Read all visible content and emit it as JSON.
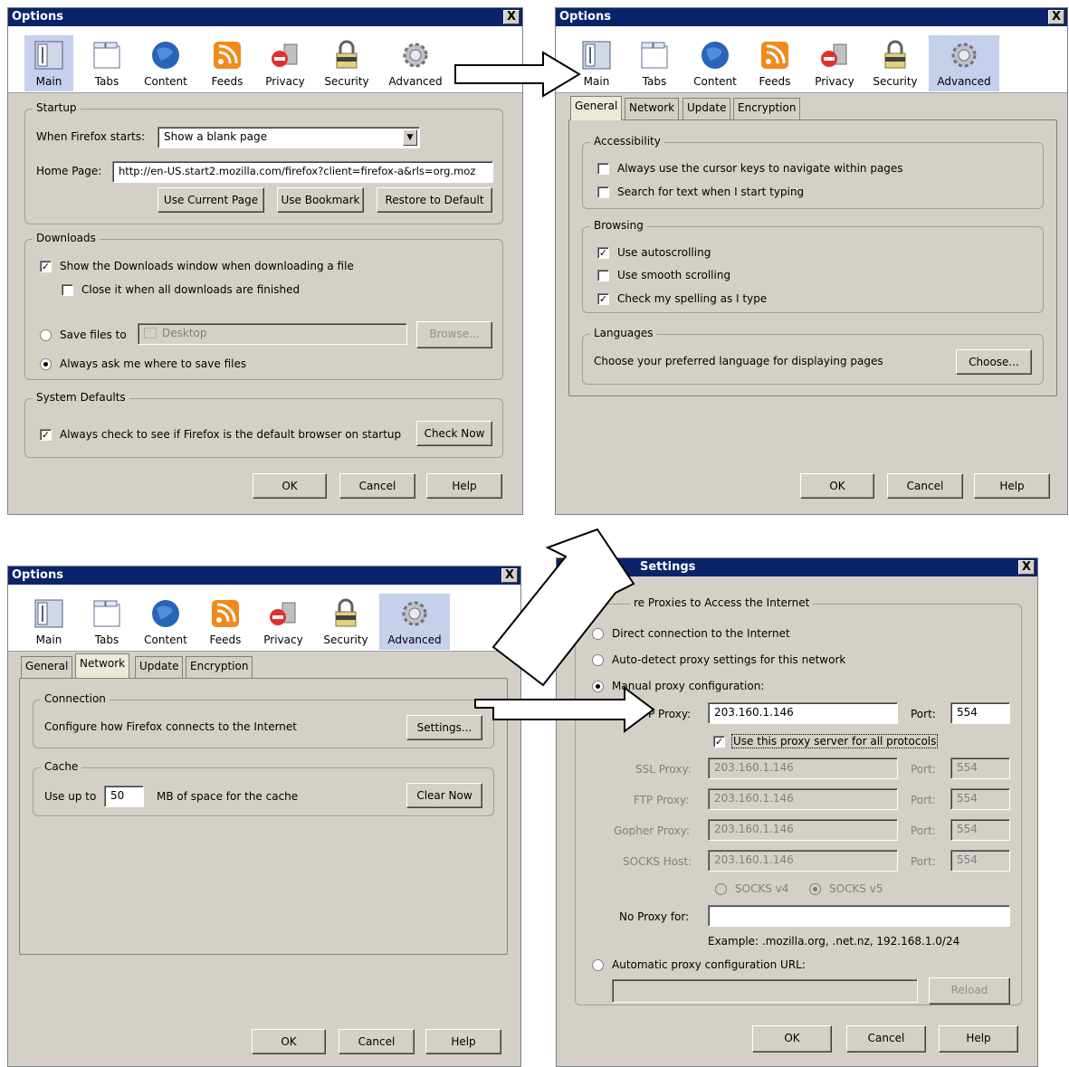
{
  "common": {
    "options_title": "Options",
    "close_glyph": "X",
    "toolbar": [
      "Main",
      "Tabs",
      "Content",
      "Feeds",
      "Privacy",
      "Security",
      "Advanced"
    ],
    "ok": "OK",
    "cancel": "Cancel",
    "help": "Help",
    "tabs": [
      "General",
      "Network",
      "Update",
      "Encryption"
    ]
  },
  "main": {
    "startup_legend": "Startup",
    "when_starts_label": "When Firefox starts:",
    "when_starts_value": "Show a blank page",
    "homepage_label": "Home Page:",
    "homepage_value": "http://en-US.start2.mozilla.com/firefox?client=firefox-a&rls=org.moz",
    "use_current_page": "Use Current Page",
    "use_bookmark": "Use Bookmark",
    "restore_default": "Restore to Default",
    "downloads_legend": "Downloads",
    "show_downloads": "Show the Downloads window when downloading a file",
    "close_when_done": "Close it when all downloads are finished",
    "save_files_to": "Save files to",
    "save_folder": "Desktop",
    "browse": "Browse...",
    "always_ask": "Always ask me where to save files",
    "sysdefaults_legend": "System Defaults",
    "always_check": "Always check to see if Firefox is the default browser on startup",
    "check_now": "Check Now"
  },
  "general": {
    "accessibility_legend": "Accessibility",
    "cursor_keys": "Always use the cursor keys to navigate within pages",
    "search_text": "Search for text when I start typing",
    "browsing_legend": "Browsing",
    "autoscrolling": "Use autoscrolling",
    "smooth_scrolling": "Use smooth scrolling",
    "spelling": "Check my spelling as I type",
    "languages_legend": "Languages",
    "languages_text": "Choose your preferred language for displaying pages",
    "choose": "Choose..."
  },
  "network": {
    "connection_legend": "Connection",
    "connection_text": "Configure how Firefox connects to the Internet",
    "settings": "Settings...",
    "cache_legend": "Cache",
    "use_up_to": "Use up to",
    "cache_value": "50",
    "cache_text": "MB of space for the cache",
    "clear_now": "Clear Now"
  },
  "connection": {
    "title": "Settings",
    "legend": "re Proxies to Access the Internet",
    "direct": "Direct connection to the Internet",
    "autodetect": "Auto-detect proxy settings for this network",
    "manual": "Manual proxy configuration:",
    "http_label": "P Proxy:",
    "http_value": "203.160.1.146",
    "port_label": "Port:",
    "http_port": "554",
    "use_for_all": "Use this proxy server for all protocols",
    "ssl_label": "SSL Proxy:",
    "ftp_label": "FTP Proxy:",
    "gopher_label": "Gopher Proxy:",
    "socks_label": "SOCKS Host:",
    "proxy_value": "203.160.1.146",
    "proxy_port": "554",
    "socks4": "SOCKS v4",
    "socks5": "SOCKS v5",
    "no_proxy_label": "No Proxy for:",
    "no_proxy_value": "",
    "example": "Example: .mozilla.org, .net.nz, 192.168.1.0/24",
    "auto_url": "Automatic proxy configuration URL:",
    "auto_url_value": "",
    "reload": "Reload"
  },
  "checkbox_glyph": "✓"
}
